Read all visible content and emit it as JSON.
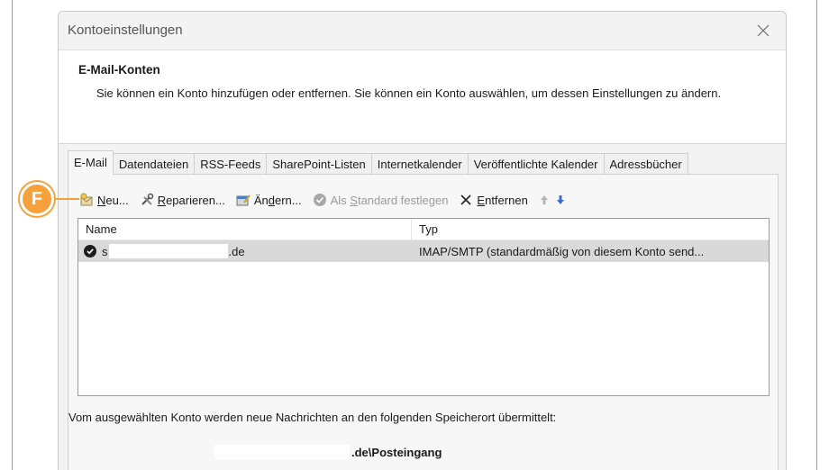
{
  "window": {
    "title": "Kontoeinstellungen"
  },
  "header": {
    "title": "E-Mail-Konten",
    "description": "Sie können ein Konto hinzufügen oder entfernen. Sie können ein Konto auswählen, um dessen Einstellungen zu ändern."
  },
  "tabs": [
    "E-Mail",
    "Datendateien",
    "RSS-Feeds",
    "SharePoint-Listen",
    "Internetkalender",
    "Veröffentlichte Kalender",
    "Adressbücher"
  ],
  "toolbar": {
    "new_u": "N",
    "new_rest": "eu...",
    "repair_u": "R",
    "repair_rest": "eparieren...",
    "change_pre": "Än",
    "change_u": "d",
    "change_rest": "ern...",
    "default_pre": "Als ",
    "default_u": "S",
    "default_rest": "tandard festlegen",
    "remove_u": "E",
    "remove_rest": "ntfernen"
  },
  "list": {
    "col_name": "Name",
    "col_type": "Typ",
    "rows": [
      {
        "name_start": "s",
        "name_end": ".de",
        "type": "IMAP/SMTP (standardmäßig von diesem Konto send..."
      }
    ]
  },
  "info_text": "Vom ausgewählten Konto werden neue Nachrichten an den folgenden Speicherort übermittelt:",
  "delivery_path_end": ".de\\Posteingang",
  "callout_label": "F",
  "accent": "#f7a13c"
}
